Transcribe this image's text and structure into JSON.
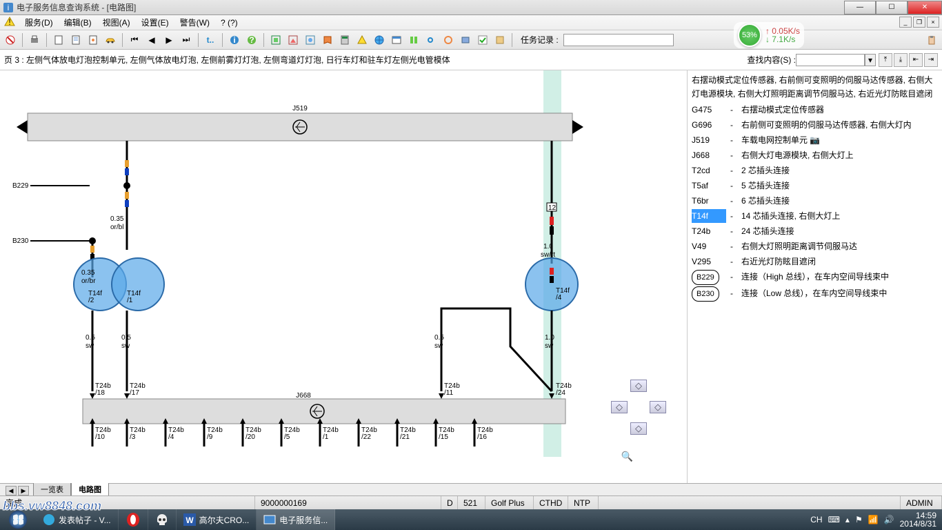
{
  "window": {
    "title": "电子服务信息查询系统 - [电路图]"
  },
  "menu": {
    "items": [
      "服务(D)",
      "编辑(B)",
      "视图(A)",
      "设置(E)",
      "警告(W)",
      "? (?)"
    ]
  },
  "toolbar": {
    "task_label": "任务记录 :"
  },
  "netspd": {
    "pct": "53%",
    "up": "0.05K/s",
    "dn": "7.1K/s"
  },
  "page_caption": "页 3 : 左侧气体放电灯泡控制单元, 左侧气体放电灯泡, 左侧前雾灯灯泡, 左侧弯道灯灯泡, 日行车灯和驻车灯左侧光电管模体",
  "find_label": "查找内容(S) :",
  "legend_head": "右摆动模式定位传感器, 右前侧可变照明的伺服马达传感器, 右侧大灯电源模块, 右侧大灯照明距离调节伺服马达, 右近光灯防眩目遮闭",
  "legend": [
    {
      "code": "G475",
      "dash": "-",
      "desc": "右摆动模式定位传感器"
    },
    {
      "code": "G696",
      "dash": "-",
      "desc": "右前侧可变照明的伺服马达传感器, 右侧大灯内"
    },
    {
      "code": "J519",
      "dash": "-",
      "desc": "车载电网控制单元 📷"
    },
    {
      "code": "J668",
      "dash": "-",
      "desc": "右侧大灯电源模块, 右侧大灯上"
    },
    {
      "code": "T2cd",
      "dash": "-",
      "desc": "2 芯插头连接"
    },
    {
      "code": "T5af",
      "dash": "-",
      "desc": "5 芯插头连接"
    },
    {
      "code": "T6br",
      "dash": "-",
      "desc": "6 芯插头连接"
    },
    {
      "code": "T14f",
      "dash": "-",
      "desc": "14 芯插头连接, 右侧大灯上",
      "sel": true
    },
    {
      "code": "T24b",
      "dash": "-",
      "desc": "24 芯插头连接"
    },
    {
      "code": "V49",
      "dash": "-",
      "desc": "右侧大灯照明距离调节伺服马达"
    },
    {
      "code": "V295",
      "dash": "-",
      "desc": "右近光灯防眩目遮闭"
    }
  ],
  "legend_ovals": [
    {
      "code": "B229",
      "desc": "连接（High 总线），在车内空间导线束中"
    },
    {
      "code": "B230",
      "desc": "连接（Low 总线），在车内空间导线束中"
    }
  ],
  "diagram": {
    "j519_label": "J519",
    "j668_label": "J668",
    "b229": "B229",
    "b230": "B230",
    "w1_gauge": "0.35",
    "w1_color": "or/bl",
    "w2_gauge": "0.35",
    "w2_color": "or/br",
    "w12_gauge": "1.0",
    "w12_color": "sw/rt",
    "w12_pin": "12",
    "t14f_2": "T14f\n/2",
    "t14f_1": "T14f\n/1",
    "t14f_4": "T14f\n/4",
    "w_left1": "0.5",
    "w_left1c": "sw",
    "w_left2": "0.5",
    "w_left2c": "sw",
    "w_mid": "0.5",
    "w_mid_c": "sw",
    "w_right": "1.0",
    "w_right_c": "sw",
    "pins_top": [
      {
        "lbl": "T24b",
        "sub": "/18"
      },
      {
        "lbl": "T24b",
        "sub": "/17"
      },
      {
        "lbl": "T24b",
        "sub": "/11"
      },
      {
        "lbl": "T24b",
        "sub": "/24"
      }
    ],
    "pins_bottom": [
      {
        "lbl": "T24b",
        "sub": "/10"
      },
      {
        "lbl": "T24b",
        "sub": "/3"
      },
      {
        "lbl": "T24b",
        "sub": "/4"
      },
      {
        "lbl": "T24b",
        "sub": "/9"
      },
      {
        "lbl": "T24b",
        "sub": "/20"
      },
      {
        "lbl": "T24b",
        "sub": "/5"
      },
      {
        "lbl": "T24b",
        "sub": "/1"
      },
      {
        "lbl": "T24b",
        "sub": "/22"
      },
      {
        "lbl": "T24b",
        "sub": "/21"
      },
      {
        "lbl": "T24b",
        "sub": "/15"
      },
      {
        "lbl": "T24b",
        "sub": "/16"
      }
    ]
  },
  "tabs": {
    "t1": "一览表",
    "t2": "电路图"
  },
  "status": {
    "done": "完成",
    "docnum": "9000000169",
    "d": "D",
    "page": "521",
    "model": "Golf Plus",
    "eng": "CTHD",
    "ntp": "NTP",
    "user": "ADMIN"
  },
  "taskbar": {
    "items": [
      {
        "icon": "ie",
        "label": "发表帖子 - V..."
      },
      {
        "icon": "opera",
        "label": ""
      },
      {
        "icon": "skull",
        "label": ""
      },
      {
        "icon": "w",
        "label": "高尔夫CRO..."
      },
      {
        "icon": "app",
        "label": "电子服务信..."
      }
    ],
    "ime": "CH",
    "time": "14:59",
    "date": "2014/8/31"
  },
  "watermark": "bbs.vw8848.com"
}
